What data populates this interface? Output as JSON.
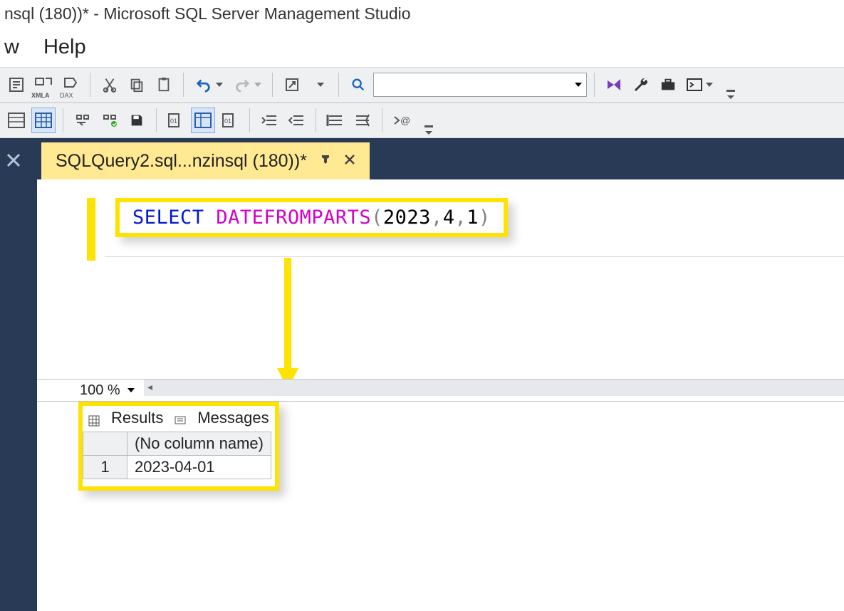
{
  "window": {
    "title": "nsql (180))* - Microsoft SQL Server Management Studio"
  },
  "menu": {
    "items": [
      "w",
      "Help"
    ]
  },
  "tab": {
    "label": "SQLQuery2.sql...nzinsql (180))*"
  },
  "query": {
    "select": "SELECT",
    "func": "DATEFROMPARTS",
    "open": "(",
    "arg1": "2023",
    "c1": ",",
    "arg2": "4",
    "c2": ",",
    "arg3": "1",
    "close": ")"
  },
  "zoom": {
    "value": "100 %"
  },
  "results": {
    "tab_results": "Results",
    "tab_messages": "Messages",
    "header": "(No column name)",
    "rownum": "1",
    "value": "2023-04-01"
  }
}
